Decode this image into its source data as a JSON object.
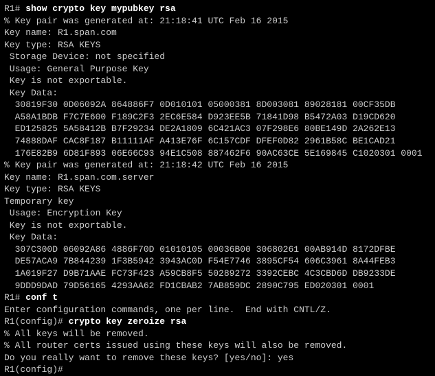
{
  "lines": [
    {
      "prompt": "R1# ",
      "cmd": "show crypto key mypubkey rsa",
      "text": ""
    },
    {
      "text": "% Key pair was generated at: 21:18:41 UTC Feb 16 2015"
    },
    {
      "text": "Key name: R1.span.com"
    },
    {
      "text": "Key type: RSA KEYS"
    },
    {
      "text": " Storage Device: not specified"
    },
    {
      "text": " Usage: General Purpose Key"
    },
    {
      "text": " Key is not exportable."
    },
    {
      "text": " Key Data:"
    },
    {
      "text": "  30819F30 0D06092A 864886F7 0D010101 05000381 8D003081 89028181 00CF35DB"
    },
    {
      "text": "  A58A1BDB F7C7E600 F189C2F3 2EC6E584 D923EE5B 71841D98 B5472A03 D19CD620"
    },
    {
      "text": "  ED125825 5A58412B B7F29234 DE2A1809 6C421AC3 07F298E6 80BE149D 2A262E13"
    },
    {
      "text": "  74888DAF CAC8F187 B11111AF A413E76F 6C157CDF DFEF0D82 2961B58C BE1CAD21"
    },
    {
      "text": "  176E82B9 6D81F893 06E66C93 94E1C508 887462F6 90AC63CE 5E169845 C1020301 0001"
    },
    {
      "text": "% Key pair was generated at: 21:18:42 UTC Feb 16 2015"
    },
    {
      "text": "Key name: R1.span.com.server"
    },
    {
      "text": "Key type: RSA KEYS"
    },
    {
      "text": "Temporary key"
    },
    {
      "text": " Usage: Encryption Key"
    },
    {
      "text": " Key is not exportable."
    },
    {
      "text": " Key Data:"
    },
    {
      "text": "  307C300D 06092A86 4886F70D 01010105 00036B00 30680261 00AB914D 8172DFBE"
    },
    {
      "text": "  DE57ACA9 7B844239 1F3B5942 3943AC0D F54E7746 3895CF54 606C3961 8A44FEB3"
    },
    {
      "text": "  1A019F27 D9B71AAE FC73F423 A59CB8F5 50289272 3392CEBC 4C3CBD6D DB9233DE"
    },
    {
      "text": "  9DDD9DAD 79D56165 4293AA62 FD1CBAB2 7AB859DC 2890C795 ED020301 0001"
    },
    {
      "prompt": "R1# ",
      "cmd": "conf t",
      "text": ""
    },
    {
      "text": "Enter configuration commands, one per line.  End with CNTL/Z."
    },
    {
      "prompt": "R1(config)# ",
      "cmd": "crypto key zeroize rsa",
      "text": ""
    },
    {
      "text": "% All keys will be removed."
    },
    {
      "text": "% All router certs issued using these keys will also be removed."
    },
    {
      "text": "Do you really want to remove these keys? [yes/no]: yes"
    },
    {
      "text": ""
    },
    {
      "prompt": "R1(config)#",
      "cmd": "",
      "text": ""
    }
  ]
}
